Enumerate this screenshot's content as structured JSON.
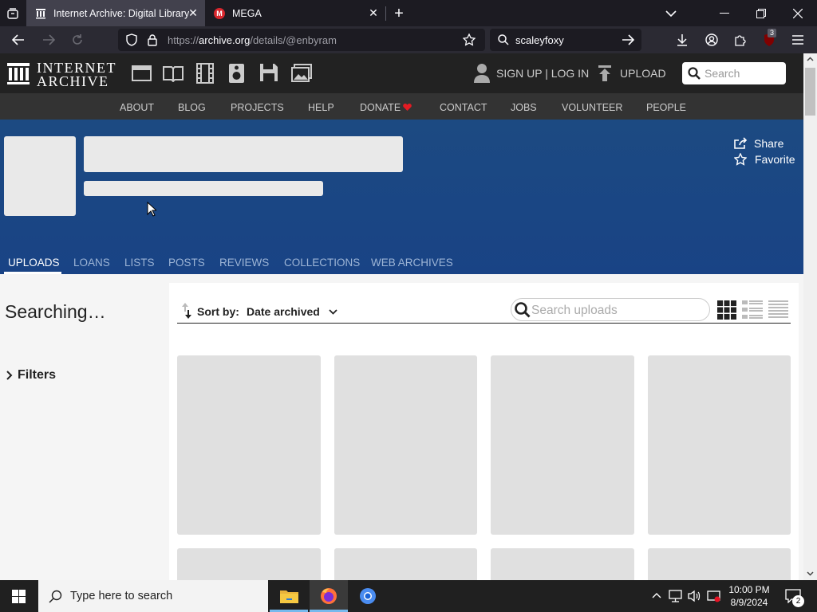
{
  "browser": {
    "tabs": [
      {
        "title": "Internet Archive: Digital Library o",
        "active": true
      },
      {
        "title": "MEGA",
        "active": false
      }
    ],
    "url_scheme": "https://",
    "url_host": "archive.org",
    "url_path": "/details/@enbyram",
    "search_value": "scaleyfoxy",
    "extension_badge": "3"
  },
  "ia": {
    "logo_line1": "INTERNET",
    "logo_line2": "ARCHIVE",
    "signup": "SIGN UP | LOG IN",
    "upload": "UPLOAD",
    "search_placeholder": "Search",
    "nav": [
      "ABOUT",
      "BLOG",
      "PROJECTS",
      "HELP",
      "DONATE",
      "CONTACT",
      "JOBS",
      "VOLUNTEER",
      "PEOPLE"
    ]
  },
  "profile": {
    "share": "Share",
    "favorite": "Favorite",
    "tabs": [
      "UPLOADS",
      "LOANS",
      "LISTS",
      "POSTS",
      "REVIEWS",
      "COLLECTIONS",
      "WEB ARCHIVES"
    ],
    "active_tab": "UPLOADS"
  },
  "results": {
    "status": "Searching…",
    "filters": "Filters",
    "sort_label": "Sort by:",
    "sort_value": "Date archived",
    "search_placeholder": "Search uploads"
  },
  "taskbar": {
    "search_placeholder": "Type here to search",
    "time": "10:00 PM",
    "date": "8/9/2024",
    "notification_count": "2"
  },
  "colors": {
    "banner": "#194385",
    "ia_header": "#222222",
    "ia_subnav": "#333333",
    "donate_heart": "#e31b23",
    "placeholder": "#e0e0e0"
  }
}
